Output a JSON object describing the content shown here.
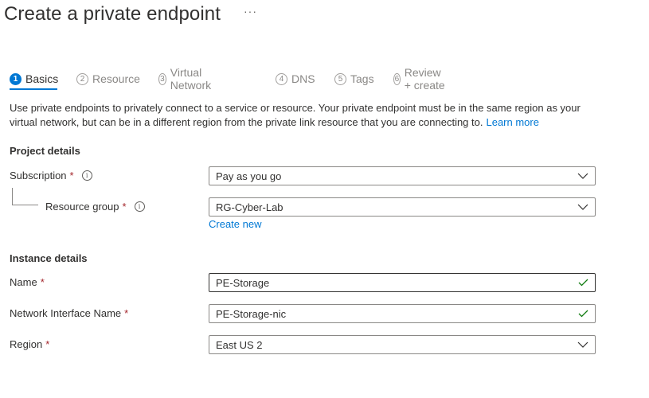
{
  "header": {
    "title": "Create a private endpoint",
    "more": "···"
  },
  "steps": [
    {
      "num": "1",
      "label": "Basics"
    },
    {
      "num": "2",
      "label": "Resource"
    },
    {
      "num": "3",
      "label": "Virtual Network"
    },
    {
      "num": "4",
      "label": "DNS"
    },
    {
      "num": "5",
      "label": "Tags"
    },
    {
      "num": "6",
      "label": "Review + create"
    }
  ],
  "description": {
    "text": "Use private endpoints to privately connect to a service or resource. Your private endpoint must be in the same region as your virtual network, but can be in a different region from the private link resource that you are connecting to.",
    "link": "Learn more"
  },
  "project": {
    "heading": "Project details",
    "subscription_label": "Subscription",
    "subscription_value": "Pay as you go",
    "rg_label": "Resource group",
    "rg_value": "RG-Cyber-Lab",
    "create_new": "Create new"
  },
  "instance": {
    "heading": "Instance details",
    "name_label": "Name",
    "name_value": "PE-Storage",
    "nic_label": "Network Interface Name",
    "nic_value": "PE-Storage-nic",
    "region_label": "Region",
    "region_value": "East US 2"
  },
  "common": {
    "required": "*",
    "info": "i"
  },
  "colors": {
    "accent": "#0078d4",
    "valid": "#107c10",
    "required": "#a4262c"
  },
  "icons": {
    "info": "info-icon",
    "dropdown": "chevron-down-icon",
    "valid": "checkmark-icon",
    "more": "more-icon"
  }
}
